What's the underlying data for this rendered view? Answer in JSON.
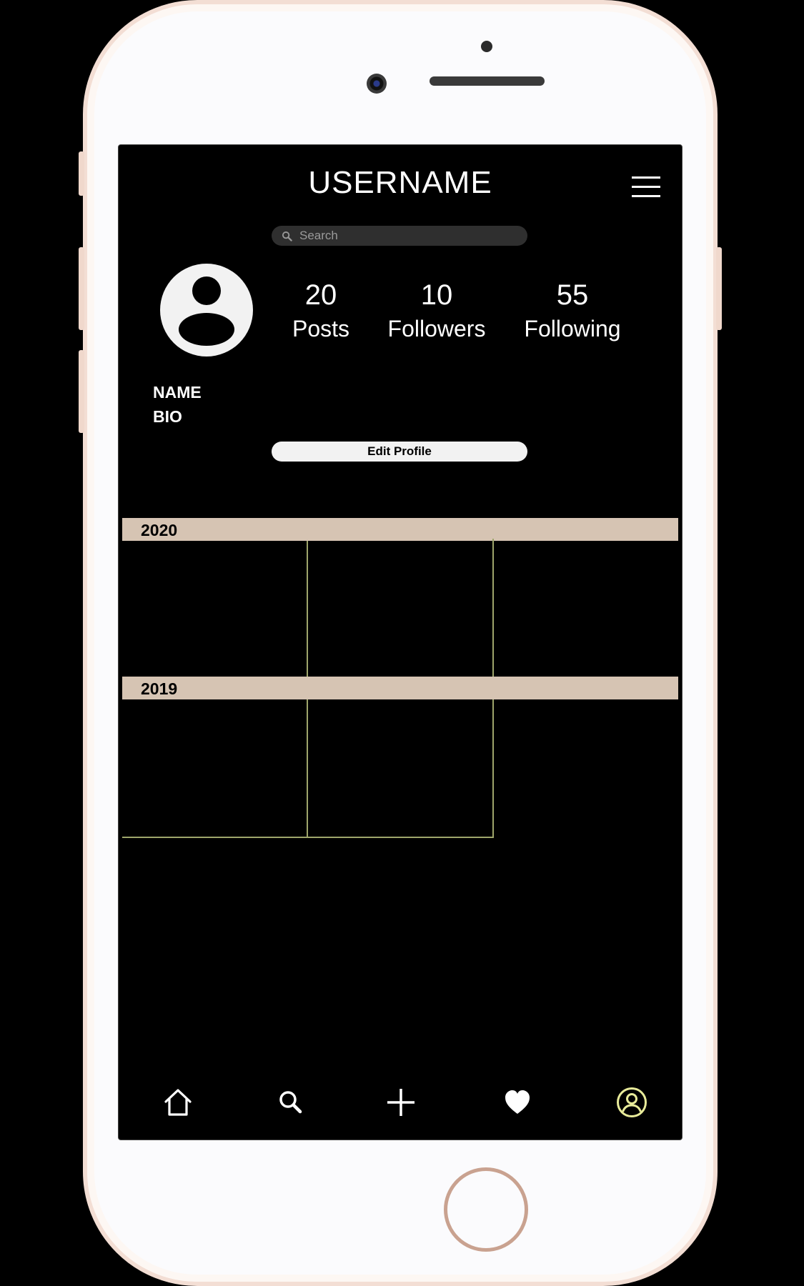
{
  "header": {
    "title": "USERNAME"
  },
  "search": {
    "placeholder": "Search"
  },
  "profile": {
    "stats": [
      {
        "value": "20",
        "label": "Posts"
      },
      {
        "value": "10",
        "label": "Followers"
      },
      {
        "value": "55",
        "label": "Following"
      }
    ],
    "name": "NAME",
    "bio": "BIO",
    "edit_label": "Edit Profile"
  },
  "timeline": {
    "years": [
      "2020",
      "2019"
    ]
  },
  "nav": {
    "items": [
      "home-icon",
      "search-icon",
      "add-icon",
      "heart-icon",
      "profile-icon"
    ],
    "active": "profile-icon",
    "active_color": "#e8eb9a"
  },
  "colors": {
    "year_bar": "#d6c4b3",
    "grid_line": "#9ea56b",
    "screen": "#000000",
    "phone_frame": "#f3ded4"
  }
}
